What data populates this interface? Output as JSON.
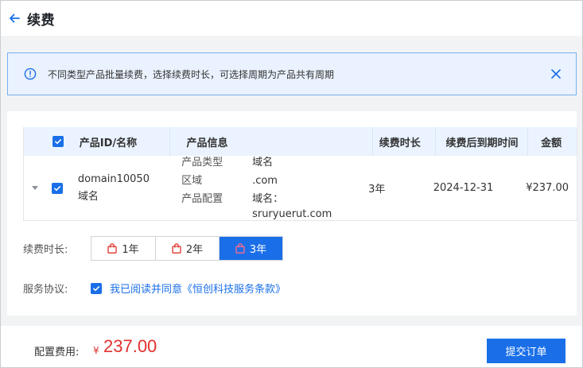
{
  "header": {
    "back_icon": "arrow-left-icon",
    "title": "续费"
  },
  "notice": {
    "icon": "info-circle-icon",
    "text": "不同类型产品批量续费，选择续费时长，可选择周期为产品共有周期",
    "close_icon": "close-icon"
  },
  "table": {
    "columns": [
      "产品ID/名称",
      "产品信息",
      "续费时长",
      "续费后到期时间",
      "金额"
    ],
    "rows": [
      {
        "id": "domain10050",
        "name": "域名",
        "info": [
          {
            "label": "产品类型",
            "value": "域名"
          },
          {
            "label": "区域",
            "value": ".com"
          },
          {
            "label": "产品配置",
            "value": "域名：sruryuerut.com"
          }
        ],
        "duration": "3年",
        "expire": "2024-12-31",
        "amount": "¥237.00"
      }
    ]
  },
  "renew": {
    "label": "续费时长:",
    "options": [
      "1年",
      "2年",
      "3年"
    ],
    "selected": "3年"
  },
  "agreement": {
    "label": "服务协议:",
    "text": "我已阅读并同意《恒创科技服务条款》",
    "checked": true
  },
  "footer": {
    "fee_label": "配置费用:",
    "currency": "¥",
    "amount": "237.00",
    "submit_label": "提交订单"
  },
  "colors": {
    "primary": "#1a6fe8",
    "price": "#e0312d",
    "notice_bg": "#e9f2fe",
    "table_header_bg": "#eaf3ff"
  }
}
